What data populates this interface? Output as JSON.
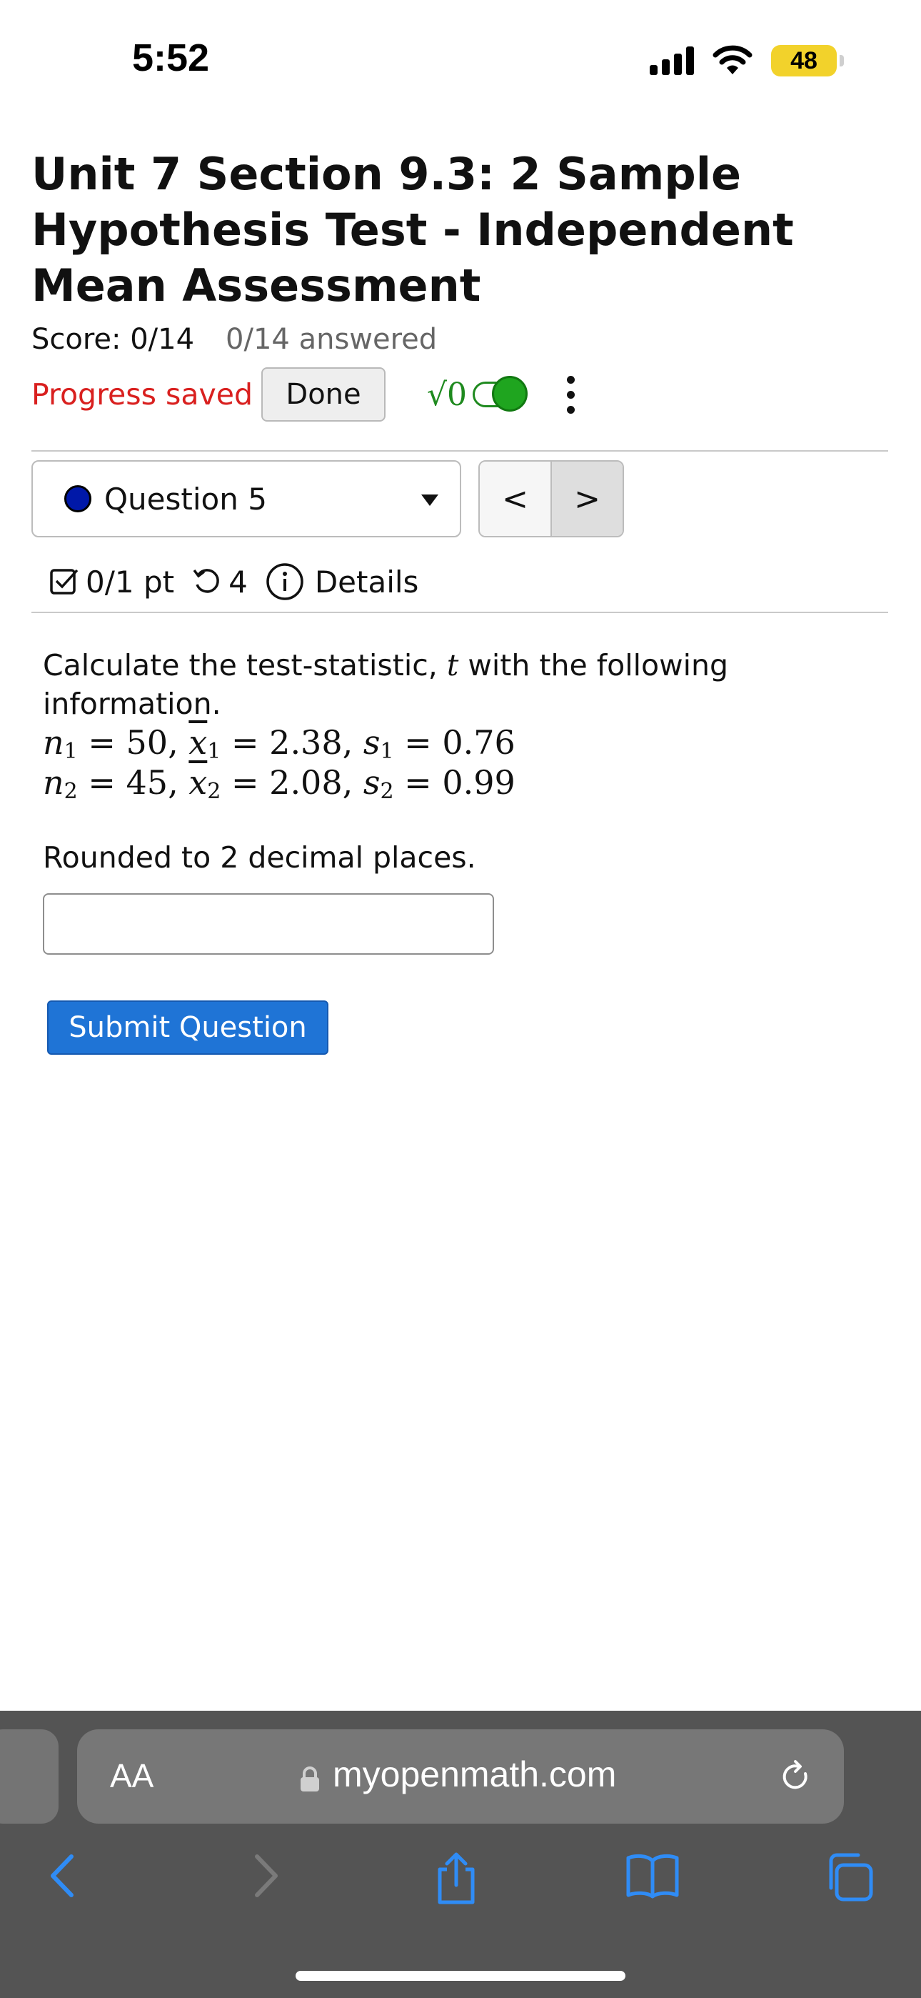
{
  "status_bar": {
    "time": "5:52",
    "battery": "48"
  },
  "assessment": {
    "title": "Unit 7 Section 9.3: 2 Sample Hypothesis Test - Independent Mean Assessment",
    "score": "Score: 0/14",
    "answered": "0/14 answered",
    "progress_saved": "Progress saved",
    "done_label": "Done",
    "math_toggle_label": "√0"
  },
  "question_nav": {
    "selected": "Question 5",
    "prev_label": "<",
    "next_label": ">"
  },
  "question_info": {
    "points": "0/1 pt",
    "attempts": "4",
    "details_label": "Details"
  },
  "question": {
    "prompt_start": "Calculate the test-statistic, ",
    "prompt_var": "t",
    "prompt_end": " with the following information.",
    "line1": {
      "n1": "50",
      "x1": "2.38",
      "s1": "0.76"
    },
    "line2": {
      "n2": "45",
      "x2": "2.08",
      "s2": "0.99"
    },
    "instruction": "Rounded to 2 decimal places.",
    "answer_value": "",
    "submit_label": "Submit Question"
  },
  "browser": {
    "text_size_label": "AA",
    "url": "myopenmath.com"
  },
  "colors": {
    "progress_saved": "#d9201f",
    "submit_button": "#1f74d6",
    "toggle_green": "#1fa51f",
    "question_dot": "#0018a8",
    "battery": "#f2d22b",
    "safari_bar": "#545454",
    "safari_icons": "#2f8cf6"
  }
}
